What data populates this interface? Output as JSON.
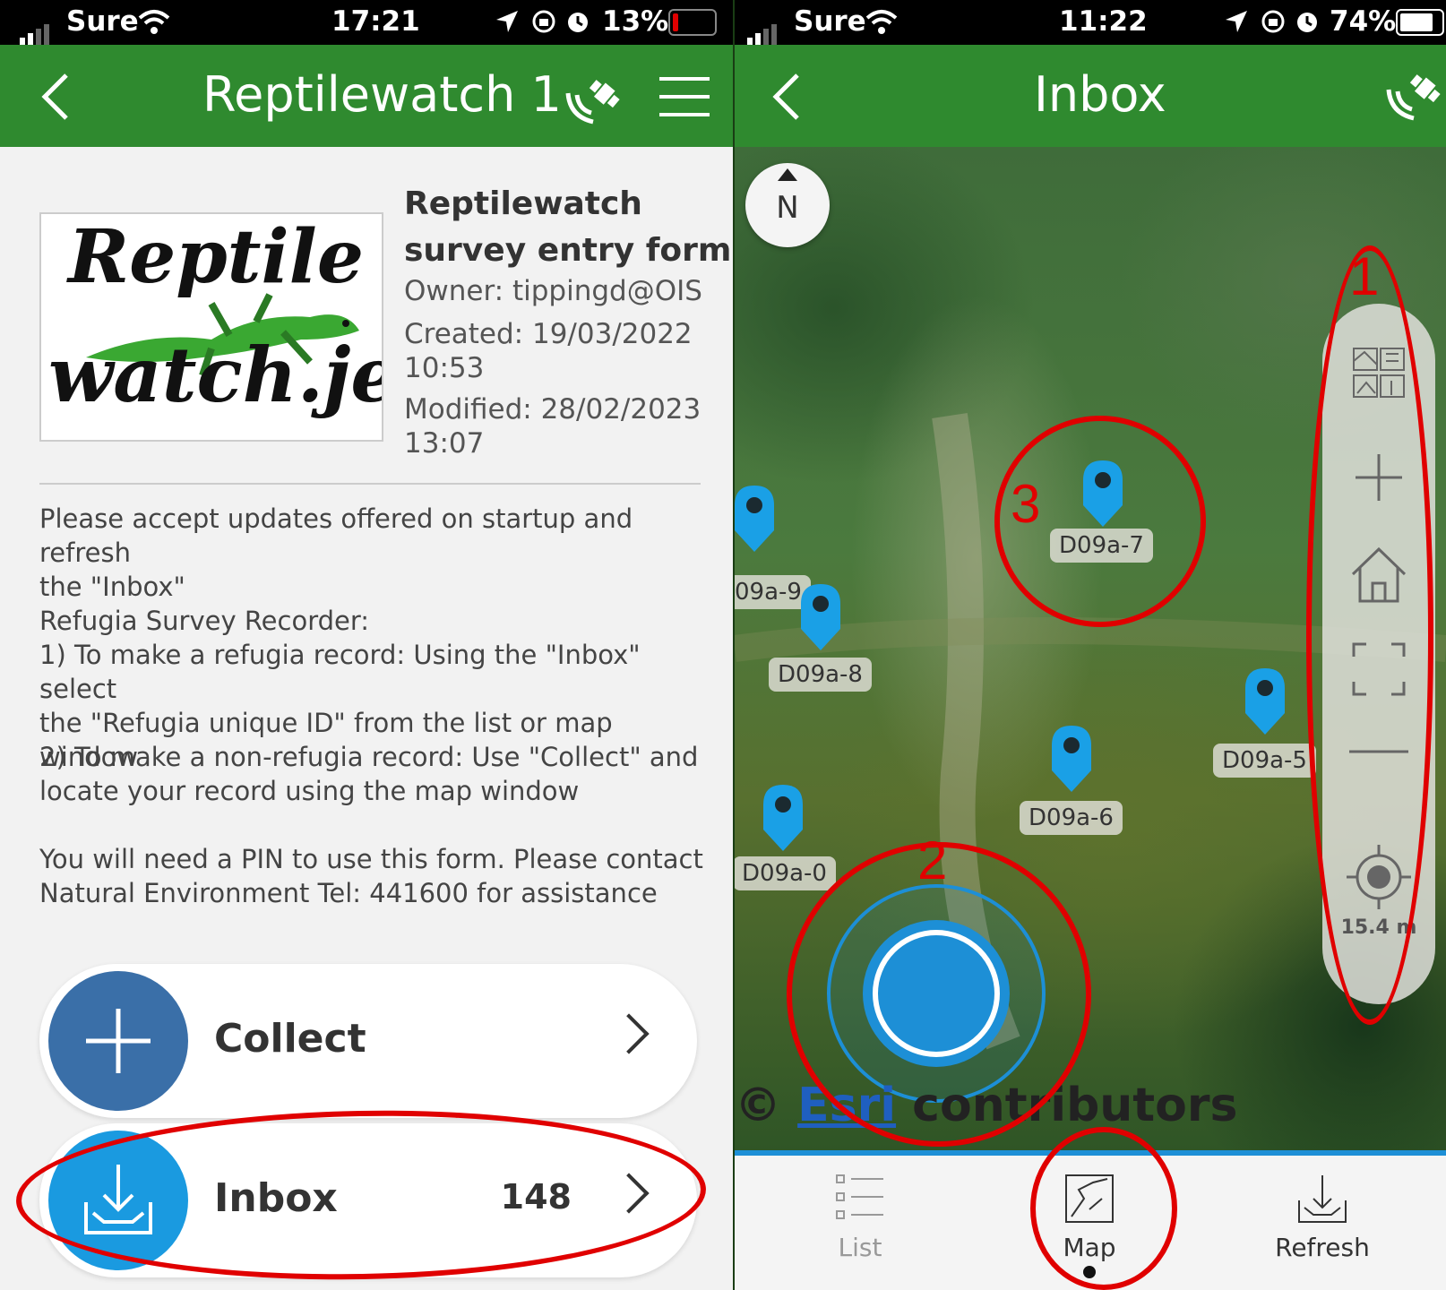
{
  "left": {
    "status": {
      "carrier": "Sure",
      "time": "17:21",
      "battery": "13%"
    },
    "appbar": {
      "title": "Reptilewatch 1"
    },
    "logo": {
      "line1": "Reptile",
      "line2": "watch.je"
    },
    "form": {
      "title_line1": "Reptilewatch",
      "title_line2": "survey entry form",
      "owner": "Owner: tippingd@OIS",
      "created": "Created: 19/03/2022",
      "created_time": "10:53",
      "modified": "Modified: 28/02/2023",
      "modified_time": "13:07"
    },
    "description": {
      "p1_l1": "Please accept updates offered on startup and refresh",
      "p1_l2": "the \"Inbox\"",
      "p2_l1": "Refugia Survey Recorder:",
      "p2_l2": "1) To make a refugia record: Using the \"Inbox\" select",
      "p2_l3": "the \"Refugia unique ID\" from the list or map window",
      "p3_l1": "2) To make a non-refugia record: Use \"Collect\" and",
      "p3_l2": "locate your record using the map window",
      "p4_l1": "You will need a PIN to use this form. Please contact",
      "p4_l2": "Natural Environment Tel: 441600 for assistance"
    },
    "actions": {
      "collect_label": "Collect",
      "inbox_label": "Inbox",
      "inbox_count": "148"
    }
  },
  "right": {
    "status": {
      "carrier": "Sure",
      "time": "11:22",
      "battery": "74%"
    },
    "appbar": {
      "title": "Inbox"
    },
    "compass": "N",
    "pins": {
      "p1": "D09a-7",
      "p2": "09a-9",
      "p3": "D09a-8",
      "p4": "D09a-6",
      "p5": "D09a-5",
      "p6": "D09a-0"
    },
    "scale": "15.4 m",
    "attribution": {
      "copyright": "©",
      "esri": "Esri",
      "rest": "contributors"
    },
    "tabs": {
      "list": "List",
      "map": "Map",
      "refresh": "Refresh"
    }
  },
  "annotations": {
    "n1": "1",
    "n2": "2",
    "n3": "3"
  },
  "colors": {
    "appbar": "#2f8a2f",
    "pin": "#1aa0e6",
    "collect": "#3a6fa8",
    "inbox": "#1a9ae0",
    "annotation": "#e00000"
  }
}
